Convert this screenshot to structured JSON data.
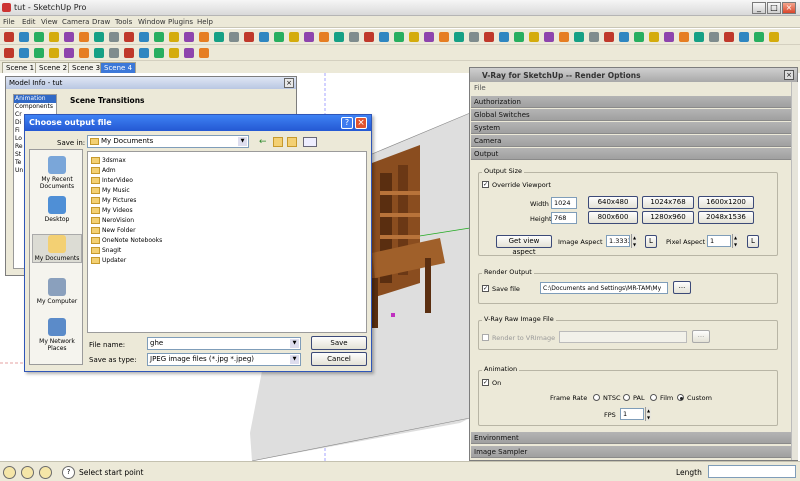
{
  "app": {
    "title": "tut - SketchUp Pro",
    "menu": [
      "File",
      "Edit",
      "View",
      "Camera",
      "Draw",
      "Tools",
      "Window",
      "Plugins",
      "Help"
    ],
    "window_controls": {
      "minimize": "_",
      "maximize": "□",
      "close": "×"
    }
  },
  "scenes": [
    "Scene 1",
    "Scene 2",
    "Scene 3",
    "Scene 4"
  ],
  "active_scene": 3,
  "model_info": {
    "title": "Model Info - tut",
    "items": [
      "Animation",
      "Components",
      "Cr",
      "Di",
      "Fi",
      "Lo",
      "Re",
      "St",
      "Te",
      "Un"
    ],
    "panel_title": "Scene Transitions"
  },
  "file_dialog": {
    "title": "Choose output file",
    "help": "?",
    "close": "×",
    "save_in_label": "Save in:",
    "save_in_value": "My Documents",
    "places": [
      "My Recent Documents",
      "Desktop",
      "My Documents",
      "My Computer",
      "My Network Places"
    ],
    "files": [
      "3dsmax",
      "Adm",
      "InterVideo",
      "My Music",
      "My Pictures",
      "My Videos",
      "NeroVision",
      "New Folder",
      "OneNote Notebooks",
      "SnagIt",
      "Updater"
    ],
    "file_name_label": "File name:",
    "file_name_value": "ghe",
    "save_type_label": "Save as type:",
    "save_type_value": "JPEG image files (*.jpg *.jpeg)",
    "save_button": "Save",
    "cancel_button": "Cancel"
  },
  "vray": {
    "title": "V-Ray for SketchUp -- Render Options",
    "menu_file": "File",
    "sections_top": [
      "Authorization",
      "Global Switches",
      "System",
      "Camera",
      "Output"
    ],
    "output_size": {
      "group_title": "Output Size",
      "override_label": "Override Viewport",
      "width_label": "Width",
      "width_value": "1024",
      "height_label": "Height",
      "height_value": "768",
      "presets": [
        "640x480",
        "1024x768",
        "1600x1200",
        "800x600",
        "1280x960",
        "2048x1536"
      ],
      "get_view_aspect": "Get view aspect",
      "image_aspect_label": "Image Aspect",
      "image_aspect_value": "1.3333",
      "pixel_aspect_label": "Pixel Aspect",
      "pixel_aspect_value": "1",
      "lock": "L"
    },
    "render_output": {
      "group_title": "Render Output",
      "save_file_label": "Save file",
      "path_value": "C:\\Documents and Settings\\MR-TAM\\My",
      "browse": "..."
    },
    "raw_image": {
      "group_title": "V-Ray Raw Image File",
      "render_to_label": "Render to VRImage",
      "browse": "..."
    },
    "animation": {
      "group_title": "Animation",
      "on_label": "On",
      "frame_rate_label": "Frame Rate",
      "rates": [
        "NTSC",
        "PAL",
        "Film",
        "Custom"
      ],
      "selected_rate": "Custom",
      "fps_label": "FPS",
      "fps_value": "1"
    },
    "sections_bottom": [
      "Environment",
      "Image Sampler"
    ]
  },
  "status": {
    "hint": "Select start point",
    "length_label": "Length"
  }
}
